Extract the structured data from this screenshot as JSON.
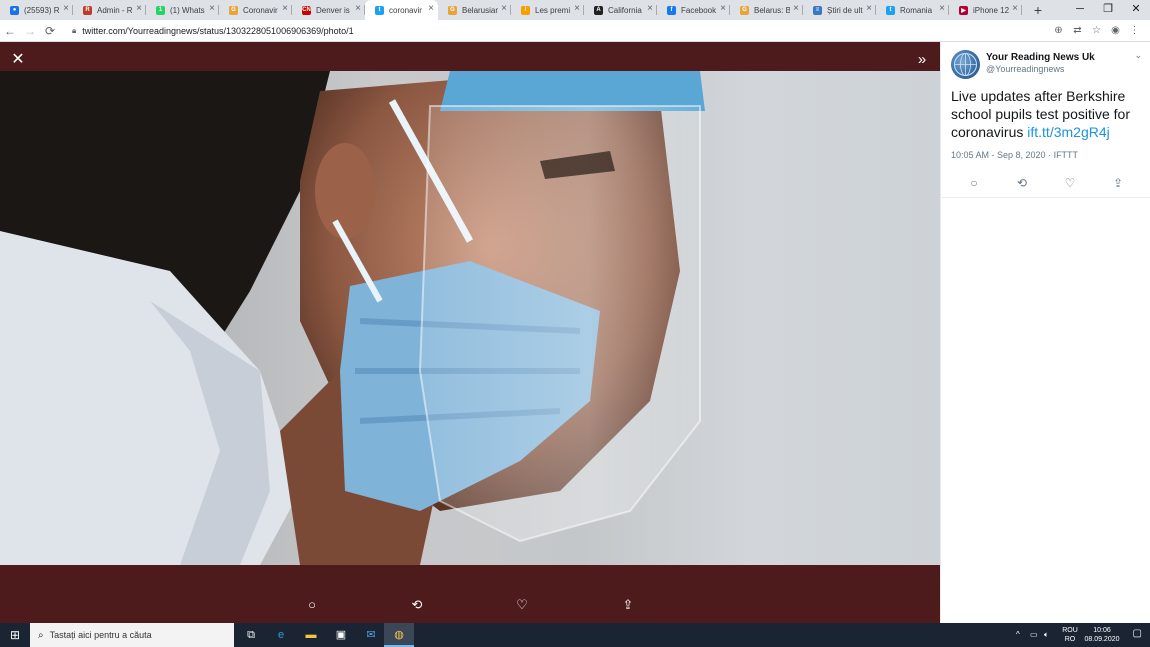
{
  "browser": {
    "tabs": [
      {
        "title": "(25593) R",
        "color": "#1a73e8",
        "glyph": "●"
      },
      {
        "title": "Admin - R",
        "color": "#c0392b",
        "glyph": "R"
      },
      {
        "title": "(1) Whats",
        "color": "#25d366",
        "glyph": "1"
      },
      {
        "title": "Coronavir",
        "color": "#e8a33d",
        "glyph": "G"
      },
      {
        "title": "Denver is",
        "color": "#cc0000",
        "glyph": "CN"
      },
      {
        "title": "coronavir",
        "color": "#1da1f2",
        "glyph": "t",
        "active": true
      },
      {
        "title": "Belarusian",
        "color": "#e8a33d",
        "glyph": "G"
      },
      {
        "title": "Les premi",
        "color": "#f59f00",
        "glyph": "/"
      },
      {
        "title": "California",
        "color": "#222222",
        "glyph": "A"
      },
      {
        "title": "Facebook",
        "color": "#1877f2",
        "glyph": "f"
      },
      {
        "title": "Belarus: Bi",
        "color": "#e8a33d",
        "glyph": "G"
      },
      {
        "title": "Știri de ult",
        "color": "#3b78c4",
        "glyph": "≡"
      },
      {
        "title": "Romania",
        "color": "#1da1f2",
        "glyph": "t"
      },
      {
        "title": "iPhone 12",
        "color": "#b3002d",
        "glyph": "▶"
      }
    ],
    "new_tab": "+",
    "url": "twitter.com/Yourreadingnews/status/1303228051006906369/photo/1"
  },
  "tweet": {
    "author_name": "Your Reading News Uk",
    "author_handle": "@Yourreadingnews",
    "text": "Live updates after Berkshire school pupils test positive for coronavirus ",
    "link": "ift.tt/3m2gR4j",
    "meta": "10:05 AM - Sep 8, 2020 · IFTTT"
  },
  "icons": {
    "close": "close-icon",
    "expand": "double-chevron-right-icon",
    "reply": "reply-icon",
    "retweet": "retweet-icon",
    "like": "heart-icon",
    "share": "share-icon"
  },
  "taskbar": {
    "search_placeholder": "Tastați aici pentru a căuta",
    "lang_top": "ROU",
    "lang_bottom": "RO",
    "time": "10:06",
    "date": "08.09.2020"
  },
  "colors": {
    "viewer_bg": "#4d1b1b",
    "link": "#1b95e0",
    "taskbar": "#1b2433"
  }
}
